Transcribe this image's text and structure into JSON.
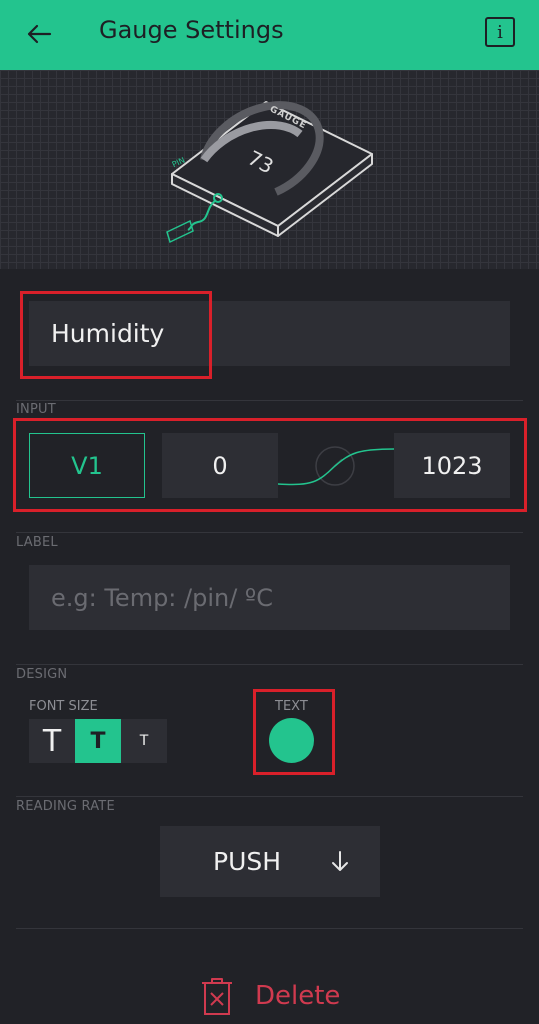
{
  "header": {
    "title": "Gauge Settings",
    "info_label": "i",
    "background": "#23c48e"
  },
  "preview": {
    "widget_label": "GAUGE",
    "gauge_value": "73",
    "pin_tag": "PIN"
  },
  "name_field": {
    "value": "Humidity"
  },
  "input": {
    "section_label": "INPUT",
    "pin": "V1",
    "min": "0",
    "max": "1023"
  },
  "label": {
    "section_label": "LABEL",
    "placeholder": "e.g: Temp: /pin/ ºC"
  },
  "design": {
    "section_label": "DESIGN",
    "font_size_label": "FONT SIZE",
    "font_sizes": [
      "T",
      "T",
      "T"
    ],
    "selected_font_size_index": 1,
    "text_color_label": "TEXT",
    "text_color": "#23c48e"
  },
  "reading_rate": {
    "section_label": "READING RATE",
    "value": "PUSH"
  },
  "delete_label": "Delete",
  "colors": {
    "accent": "#23c48e",
    "danger": "#d03a4f",
    "highlight": "#d9202a"
  }
}
